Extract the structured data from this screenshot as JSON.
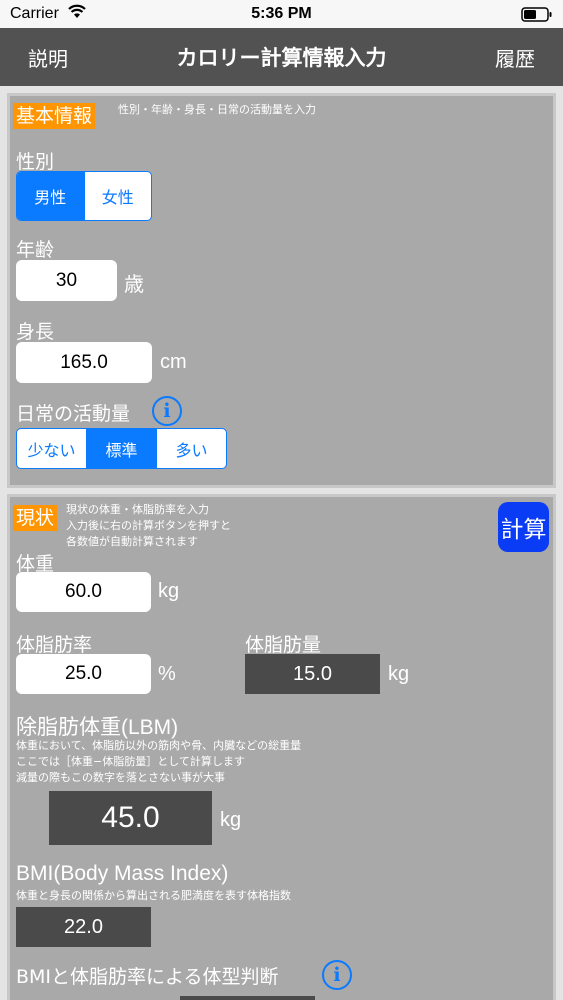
{
  "status": {
    "carrier": "Carrier",
    "time": "5:36 PM"
  },
  "nav": {
    "left": "説明",
    "title": "カロリー計算情報入力",
    "right": "履歴"
  },
  "basic": {
    "tag": "基本情報",
    "hint": "性別・年齢・身長・日常の活動量を入力",
    "gender_label": "性別",
    "gender_options": [
      "男性",
      "女性"
    ],
    "gender_selected": "男性",
    "age_label": "年齢",
    "age_value": "30",
    "age_unit": "歳",
    "height_label": "身長",
    "height_value": "165.0",
    "height_unit": "cm",
    "activity_label": "日常の活動量",
    "activity_options": [
      "少ない",
      "標準",
      "多い"
    ],
    "activity_selected": "標準"
  },
  "current": {
    "tag": "現状",
    "hint": [
      "現状の体重・体脂肪率を入力",
      "入力後に右の計算ボタンを押すと",
      "各数値が自動計算されます"
    ],
    "calc_button": "計算",
    "weight_label": "体重",
    "weight_value": "60.0",
    "weight_unit": "kg",
    "fat_rate_label": "体脂肪率",
    "fat_rate_value": "25.0",
    "fat_rate_unit": "%",
    "fat_mass_label": "体脂肪量",
    "fat_mass_value": "15.0",
    "fat_mass_unit": "kg",
    "lbm_label": "除脂肪体重(LBM)",
    "lbm_desc": [
      "体重において、体脂肪以外の筋肉や骨、内臓などの総重量",
      "ここでは［体重−体脂肪量］として計算します",
      "減量の際もこの数字を落とさない事が大事"
    ],
    "lbm_value": "45.0",
    "lbm_unit": "kg",
    "bmi_label": "BMI(Body Mass Index)",
    "bmi_desc": "体重と身長の関係から算出される肥満度を表す体格指数",
    "bmi_value": "22.0",
    "body_type_label": "BMIと体脂肪率による体型判断"
  },
  "colors": {
    "accent": "#0a7aff",
    "tag": "#ff9500",
    "calc": "#0a3bf5",
    "nav": "#525252",
    "panel": "#a9a9a9",
    "output": "#4b4a4b"
  }
}
